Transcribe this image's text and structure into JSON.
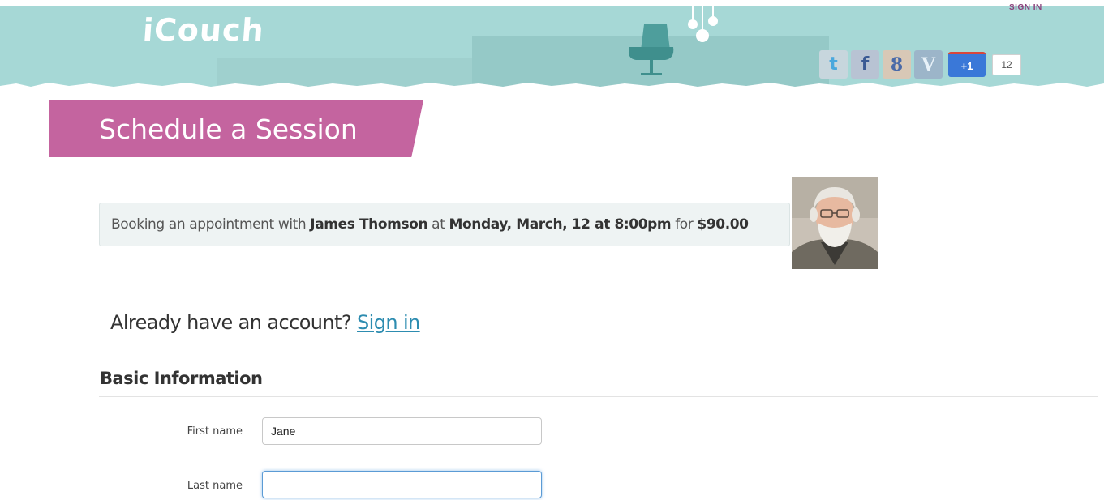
{
  "header": {
    "logo": "iCouch",
    "sign_in_label": "SIGN IN",
    "social": {
      "twitter_glyph": "t",
      "facebook_glyph": "f",
      "googleplus_glyph": "8",
      "vimeo_glyph": "V",
      "plus_one_label": "+1",
      "plus_one_count": "12"
    }
  },
  "page": {
    "title": "Schedule a Session"
  },
  "booking": {
    "prefix": "Booking an appointment with ",
    "therapist": "James Thomson",
    "at": " at ",
    "datetime": "Monday, March, 12 at 8:00pm",
    "for": " for ",
    "price": "$90.00"
  },
  "account": {
    "prompt": "Already have an account? ",
    "sign_in_link": "Sign in"
  },
  "form": {
    "section_title": "Basic Information",
    "first_name": {
      "label": "First name",
      "value": "Jane"
    },
    "last_name": {
      "label": "Last name",
      "value": ""
    }
  },
  "colors": {
    "header_bg": "#a6d8d6",
    "banner": "#c4649f",
    "link": "#2d8cb0"
  }
}
